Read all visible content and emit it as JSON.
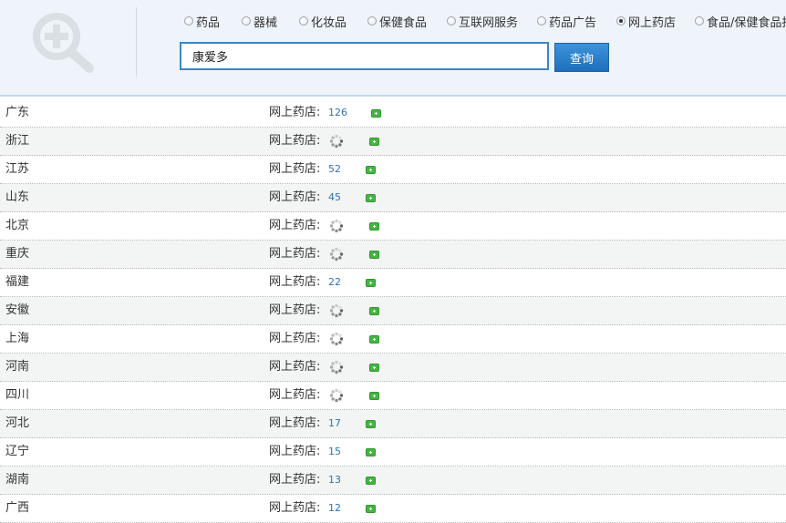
{
  "search": {
    "categories": [
      {
        "label": "药品",
        "checked": false
      },
      {
        "label": "器械",
        "checked": false
      },
      {
        "label": "化妆品",
        "checked": false
      },
      {
        "label": "保健食品",
        "checked": false
      },
      {
        "label": "互联网服务",
        "checked": false
      },
      {
        "label": "药品广告",
        "checked": false
      },
      {
        "label": "网上药店",
        "checked": true
      },
      {
        "label": "食品/保健食品批",
        "checked": false
      }
    ],
    "query_value": "康爱多",
    "submit_label": "查询"
  },
  "results": {
    "rows": [
      {
        "province": "广东",
        "label": "网上药店:",
        "count": "126",
        "loading": false
      },
      {
        "province": "浙江",
        "label": "网上药店:",
        "count": "",
        "loading": true
      },
      {
        "province": "江苏",
        "label": "网上药店:",
        "count": "52",
        "loading": false
      },
      {
        "province": "山东",
        "label": "网上药店:",
        "count": "45",
        "loading": false
      },
      {
        "province": "北京",
        "label": "网上药店:",
        "count": "",
        "loading": true
      },
      {
        "province": "重庆",
        "label": "网上药店:",
        "count": "",
        "loading": true
      },
      {
        "province": "福建",
        "label": "网上药店:",
        "count": "22",
        "loading": false
      },
      {
        "province": "安徽",
        "label": "网上药店:",
        "count": "",
        "loading": true
      },
      {
        "province": "上海",
        "label": "网上药店:",
        "count": "",
        "loading": true
      },
      {
        "province": "河南",
        "label": "网上药店:",
        "count": "",
        "loading": true
      },
      {
        "province": "四川",
        "label": "网上药店:",
        "count": "",
        "loading": true
      },
      {
        "province": "河北",
        "label": "网上药店:",
        "count": "17",
        "loading": false
      },
      {
        "province": "辽宁",
        "label": "网上药店:",
        "count": "15",
        "loading": false
      },
      {
        "province": "湖南",
        "label": "网上药店:",
        "count": "13",
        "loading": false
      },
      {
        "province": "广西",
        "label": "网上药店:",
        "count": "12",
        "loading": false
      }
    ]
  },
  "colors": {
    "header_bg": "#eef4fa",
    "accent_blue": "#2f73b8",
    "button_blue": "#1f6fba",
    "expand_green": "#47b545"
  },
  "icons": {
    "logo": "magnifier-plus-icon",
    "loading": "loading-spinner-icon",
    "expand": "plus-icon"
  }
}
